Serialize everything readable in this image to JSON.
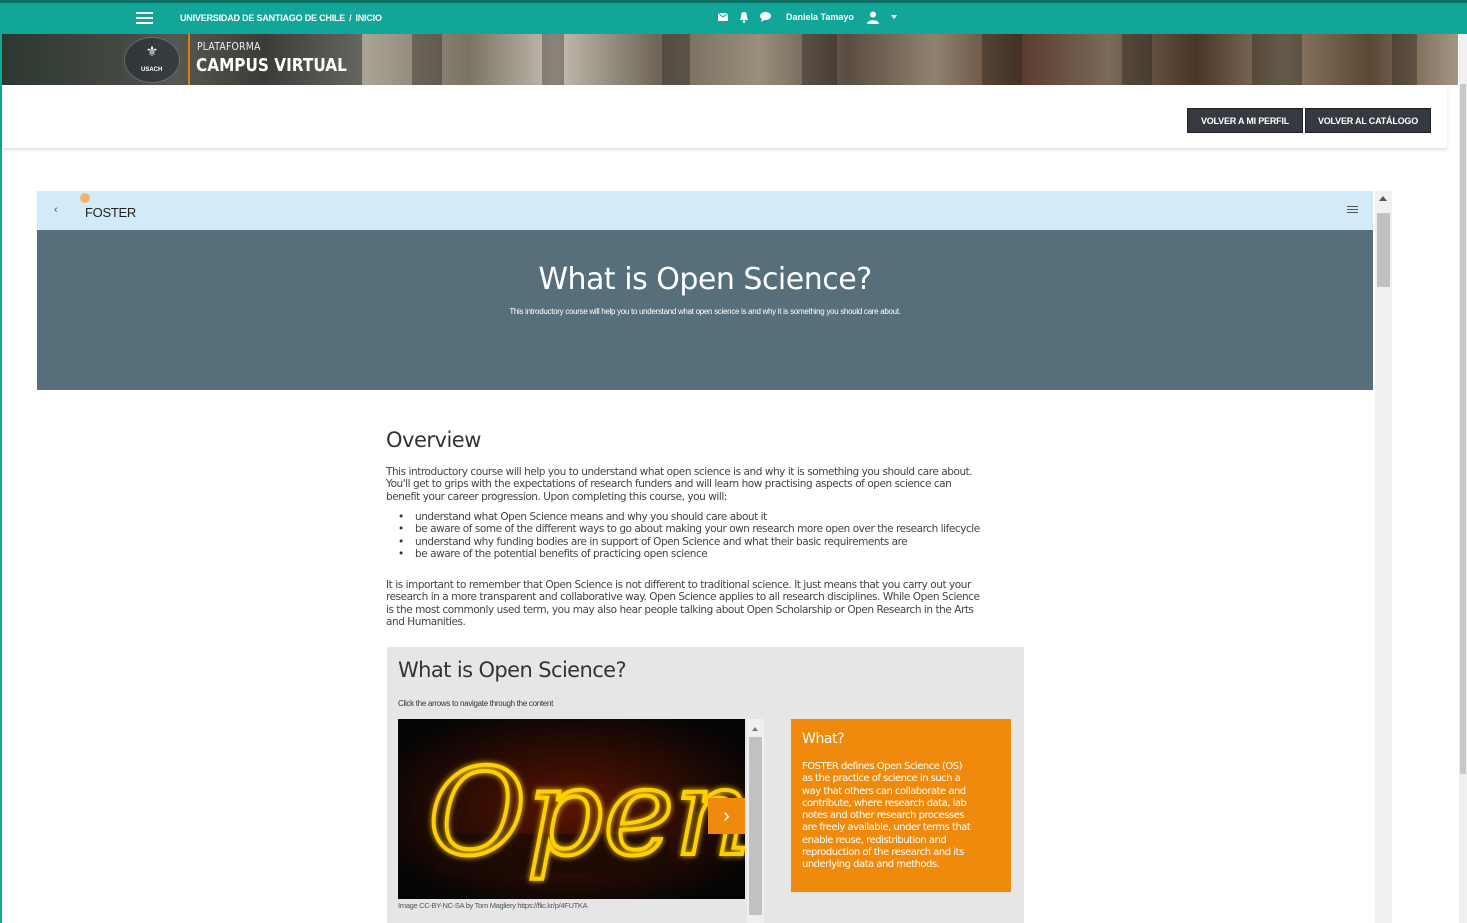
{
  "topbar": {
    "breadcrumb_org": "UNIVERSIDAD DE SANTIAGO DE CHILE",
    "breadcrumb_sep": "/",
    "breadcrumb_current": "INICIO",
    "user_name": "Daniela Tamayo",
    "icons": [
      "menu-icon",
      "mail-icon",
      "bell-icon",
      "chat-icon",
      "user-icon",
      "caret-down-icon"
    ],
    "color": "#12a699"
  },
  "banner": {
    "logo_text": "USACH",
    "plataforma": "PLATAFORMA",
    "campus": "CAMPUS VIRTUAL",
    "accent": "#e07b12"
  },
  "actions": {
    "profile_button": "VOLVER A MI PERFIL",
    "catalog_button": "VOLVER AL CATÁLOGO"
  },
  "course": {
    "name": "FOSTER",
    "hero_title": "What is Open Science?",
    "hero_subtitle": "This introductory course will help you to understand what open science is and why it is something you should care about.",
    "hero_color": "#566f7b",
    "bar_color": "#d3eaf8"
  },
  "overview": {
    "heading": "Overview",
    "intro_lines": [
      "This introductory course will help you to understand what open science is and why it is something you should care about.",
      "You'll get to grips with the expectations of research funders and will learn how practising aspects of open science can",
      "benefit your career progression. Upon completing this course, you will:"
    ],
    "bullets": [
      "understand what Open Science means and why you should care about it",
      "be aware of some of the different ways to go about making your own research more open over the research lifecycle",
      "understand why funding bodies are in support of Open Science and what their basic requirements are",
      "be aware of the potential benefits of practicing open science"
    ],
    "note_lines": [
      "It is important to remember that Open Science is not different to traditional science. It just means that you carry out your",
      "research in a more transparent and collaborative way. Open Science applies to all research disciplines. While Open Science",
      "is the most commonly used term, you may also hear people talking about Open Scholarship or Open Research in the Arts",
      "and Humanities."
    ]
  },
  "module": {
    "title": "What is Open Science?",
    "instruction": "Click the arrows to navigate through the content",
    "image_word": "Open",
    "image_credit": "Image CC-BY-NC-SA by Tom Magliery https://flic.kr/p/4FUTKA",
    "next_label": "›",
    "card_title": "What?",
    "card_lines": [
      "FOSTER defines Open Science (OS)",
      "as the practice of science in such a",
      "way that others can collaborate and",
      "contribute, where research data, lab",
      "notes and other research processes",
      "are freely available, under terms that",
      "enable reuse, redistribution and",
      "reproduction of the research and its",
      "underlying data and methods."
    ],
    "card_color": "#f08a0c"
  }
}
